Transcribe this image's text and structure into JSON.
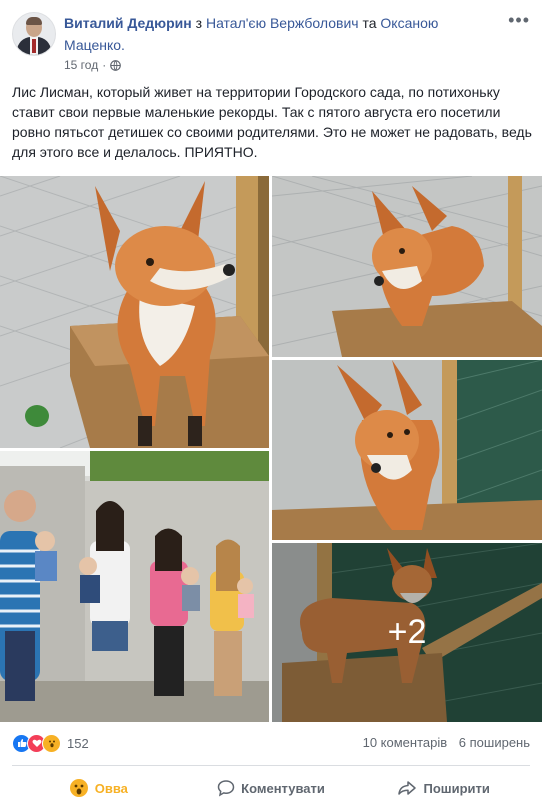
{
  "post": {
    "author": "Виталий Дедюрин",
    "with_prefix": "з",
    "tagged_1": "Натал'єю Вержболович",
    "conj": "та",
    "tagged_2": "Оксаною Маценко.",
    "time": "15 год",
    "dot": "·",
    "privacy_icon": "globe-icon",
    "more_icon": "more-horizontal-icon",
    "more_glyph": "•••",
    "text": "Лис Лисман, который живет на территории Городского сада, по потихоньку ставит свои первые маленькие рекорды. Так с пятого августа его посетили ровно пятьсот детишек со своими родителями. Это не может не радовать, ведь для этого все и делалось. ПРИЯТНО."
  },
  "photos": {
    "more_count": "+2",
    "items": [
      {
        "name": "fox-on-box-photo"
      },
      {
        "name": "fox-looking-up-photo"
      },
      {
        "name": "families-with-children-photo"
      },
      {
        "name": "fox-closeup-photo"
      },
      {
        "name": "fox-on-ramp-photo"
      }
    ]
  },
  "reactions": {
    "icons": [
      "like-icon",
      "love-icon",
      "wow-icon"
    ],
    "count": "152",
    "comments": "10 коментарів",
    "shares": "6 поширень"
  },
  "actions": {
    "wow_label": "Овва",
    "comment_label": "Коментувати",
    "share_label": "Поширити"
  },
  "colors": {
    "link": "#385898",
    "like": "#1877f2",
    "love": "#f33e58",
    "wow": "#f7b125",
    "muted": "#606770"
  }
}
